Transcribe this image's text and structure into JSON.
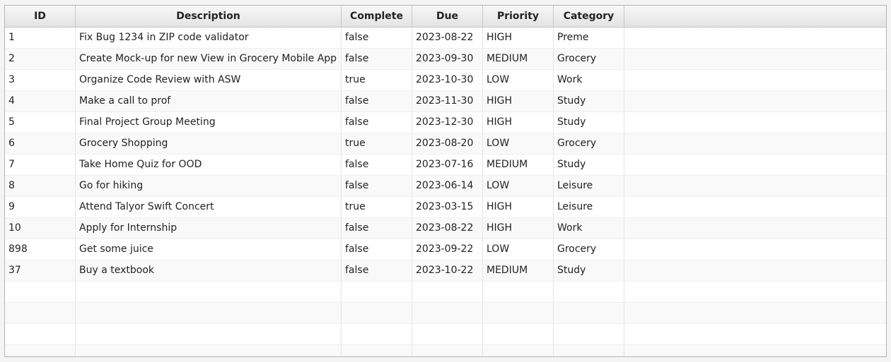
{
  "table": {
    "columns": [
      "ID",
      "Description",
      "Complete",
      "Due",
      "Priority",
      "Category"
    ],
    "rows": [
      [
        "1",
        "Fix Bug 1234 in ZIP code validator",
        "false",
        "2023-08-22",
        "HIGH",
        "Preme"
      ],
      [
        "2",
        "Create Mock-up for new View in Grocery Mobile App",
        "false",
        "2023-09-30",
        "MEDIUM",
        "Grocery"
      ],
      [
        "3",
        "Organize Code Review with ASW",
        "true",
        "2023-10-30",
        "LOW",
        "Work"
      ],
      [
        "4",
        "Make a call to prof",
        "false",
        "2023-11-30",
        "HIGH",
        "Study"
      ],
      [
        "5",
        "Final Project Group Meeting",
        "false",
        "2023-12-30",
        "HIGH",
        "Study"
      ],
      [
        "6",
        "Grocery Shopping",
        "true",
        "2023-08-20",
        "LOW",
        "Grocery"
      ],
      [
        "7",
        "Take Home Quiz for OOD",
        "false",
        "2023-07-16",
        "MEDIUM",
        "Study"
      ],
      [
        "8",
        "Go for hiking",
        "false",
        "2023-06-14",
        "LOW",
        "Leisure"
      ],
      [
        "9",
        "Attend Talyor Swift Concert",
        "true",
        "2023-03-15",
        "HIGH",
        "Leisure"
      ],
      [
        "10",
        "Apply for Internship",
        "false",
        "2023-08-22",
        "HIGH",
        "Work"
      ],
      [
        "898",
        "Get some juice",
        "false",
        "2023-09-22",
        "LOW",
        "Grocery"
      ],
      [
        "37",
        "Buy a textbook",
        "false",
        "2023-10-22",
        "MEDIUM",
        "Study"
      ]
    ]
  }
}
